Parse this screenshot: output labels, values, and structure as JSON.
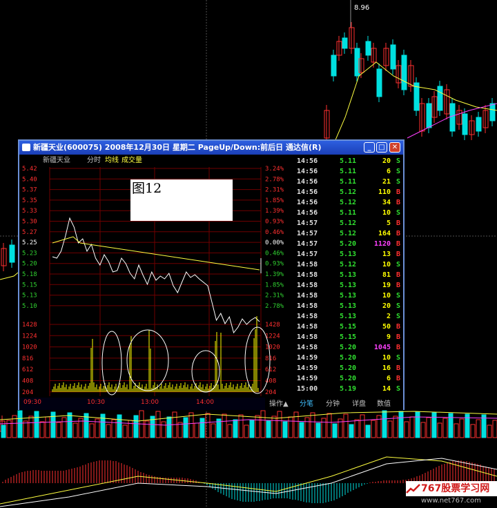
{
  "background_chart": {
    "peak_label": "8.96"
  },
  "window": {
    "title": "新疆天业(600075)  2008年12月30日  星期二  PageUp/Down:前后日  通达信(R)",
    "header": {
      "stock_name": "新疆天业",
      "mode": "分时",
      "avg_label": "均线",
      "vol_label": "成交量"
    },
    "figure_label": "图12",
    "price_axis": {
      "left": [
        "5.42",
        "5.40",
        "5.37",
        "5.35",
        "5.33",
        "5.30",
        "5.27",
        "5.25",
        "5.23",
        "5.20",
        "5.18",
        "5.15",
        "5.13",
        "5.10"
      ],
      "right": [
        "3.24%",
        "2.78%",
        "2.31%",
        "1.85%",
        "1.39%",
        "0.93%",
        "0.46%",
        "0.00%",
        "0.46%",
        "0.93%",
        "1.39%",
        "1.85%",
        "2.31%",
        "2.78%"
      ]
    },
    "volume_axis": {
      "left": [
        "1428",
        "1224",
        "1020",
        "816",
        "612",
        "408",
        "204"
      ],
      "right": [
        "1428",
        "1224",
        "1020",
        "816",
        "612",
        "408",
        "204"
      ]
    },
    "time_axis": [
      "09:30",
      "10:30",
      "13:00",
      "14:00"
    ],
    "ticks": [
      {
        "time": "14:56",
        "price": "5.11",
        "vol": "20",
        "flag": "S"
      },
      {
        "time": "14:56",
        "price": "5.11",
        "vol": "6",
        "flag": "S"
      },
      {
        "time": "14:56",
        "price": "5.11",
        "vol": "21",
        "flag": "S"
      },
      {
        "time": "14:56",
        "price": "5.12",
        "vol": "110",
        "flag": "B"
      },
      {
        "time": "14:56",
        "price": "5.12",
        "vol": "34",
        "flag": "B"
      },
      {
        "time": "14:56",
        "price": "5.11",
        "vol": "10",
        "flag": "S"
      },
      {
        "time": "14:57",
        "price": "5.12",
        "vol": "5",
        "flag": "B"
      },
      {
        "time": "14:57",
        "price": "5.12",
        "vol": "164",
        "flag": "B"
      },
      {
        "time": "14:57",
        "price": "5.20",
        "vol": "1120",
        "flag": "B"
      },
      {
        "time": "14:57",
        "price": "5.13",
        "vol": "13",
        "flag": "B"
      },
      {
        "time": "14:58",
        "price": "5.12",
        "vol": "10",
        "flag": "S"
      },
      {
        "time": "14:58",
        "price": "5.13",
        "vol": "81",
        "flag": "B"
      },
      {
        "time": "14:58",
        "price": "5.13",
        "vol": "19",
        "flag": "B"
      },
      {
        "time": "14:58",
        "price": "5.13",
        "vol": "10",
        "flag": "S"
      },
      {
        "time": "14:58",
        "price": "5.13",
        "vol": "20",
        "flag": "S"
      },
      {
        "time": "14:58",
        "price": "5.13",
        "vol": "2",
        "flag": "S"
      },
      {
        "time": "14:58",
        "price": "5.15",
        "vol": "50",
        "flag": "B"
      },
      {
        "time": "14:58",
        "price": "5.15",
        "vol": "9",
        "flag": "B"
      },
      {
        "time": "14:58",
        "price": "5.20",
        "vol": "1045",
        "flag": "B"
      },
      {
        "time": "14:59",
        "price": "5.20",
        "vol": "10",
        "flag": "S"
      },
      {
        "time": "14:59",
        "price": "5.20",
        "vol": "16",
        "flag": "B"
      },
      {
        "time": "14:59",
        "price": "5.20",
        "vol": "6",
        "flag": "B"
      },
      {
        "time": "15:00",
        "price": "5.19",
        "vol": "14",
        "flag": "S"
      }
    ],
    "tabs": [
      "操作▲",
      "分笔",
      "分钟",
      "详盘",
      "数值"
    ]
  },
  "watermark": {
    "text": "767股票学习网",
    "url": "www.net767.com"
  },
  "colors": {
    "up": "#ff3030",
    "down": "#00e0e0",
    "price_line": "#ffffff",
    "avg_line": "#ffff40",
    "volume": "#ffff00",
    "buy_flag": "#ff3030",
    "sell_flag": "#30e030",
    "big_vol": "#ff40ff"
  }
}
